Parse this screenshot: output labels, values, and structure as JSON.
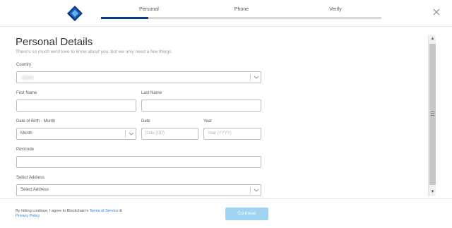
{
  "header": {
    "logo_icon": "blockchain-logo-icon",
    "steps": [
      {
        "label": "Personal",
        "active": true
      },
      {
        "label": "Phone",
        "active": false
      },
      {
        "label": "Verify",
        "active": false
      }
    ],
    "progress_fraction": 0.17,
    "close_icon": "close-icon"
  },
  "form": {
    "title": "Personal Details",
    "subtitle": "There's so much we'd love to know about you, but we only need a few things.",
    "country": {
      "label": "Country",
      "value": ""
    },
    "first_name": {
      "label": "First Name",
      "value": ""
    },
    "last_name": {
      "label": "Last Name",
      "value": ""
    },
    "dob_month": {
      "label": "Date of Birth - Month",
      "value": "Month"
    },
    "dob_date": {
      "label": "Date",
      "placeholder": "Date (DD)"
    },
    "dob_year": {
      "label": "Year",
      "placeholder": "Year (YYYY)"
    },
    "postcode": {
      "label": "Postcode",
      "value": ""
    },
    "address": {
      "label": "Select Address",
      "value": "Select Address"
    }
  },
  "footer": {
    "terms_prefix": "By hitting continue, I agree to Blockchain's",
    "terms_link": "Terms of Service",
    "terms_and": "&",
    "privacy_link": "Privacy Policy",
    "continue_label": "Continue"
  },
  "colors": {
    "brand_dark": "#0d3d8a",
    "brand_light": "#2f7fd6",
    "continue_bg": "#9fd4f3",
    "progress_track": "#d9d9d9"
  }
}
